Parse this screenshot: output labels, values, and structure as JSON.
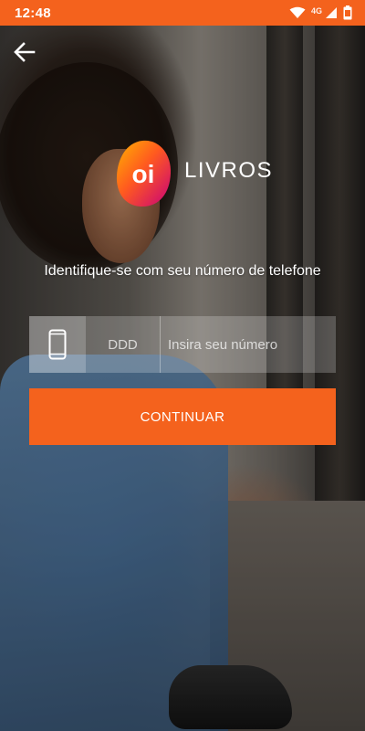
{
  "status_bar": {
    "time": "12:48",
    "network": "4G",
    "icons": [
      "wifi-icon",
      "signal-icon",
      "battery-icon"
    ],
    "color": "#f4621d"
  },
  "nav": {
    "back_icon": "arrow-left-icon"
  },
  "logo": {
    "mark_text": "oi",
    "brand_text": "LIVROS"
  },
  "login": {
    "prompt": "Identifique-se com seu número de telefone",
    "phone_icon": "smartphone-icon",
    "ddd": {
      "value": "",
      "placeholder": "DDD"
    },
    "number": {
      "value": "",
      "placeholder": "Insira seu número"
    },
    "continue_label": "CONTINUAR"
  },
  "colors": {
    "accent": "#f4621d"
  }
}
